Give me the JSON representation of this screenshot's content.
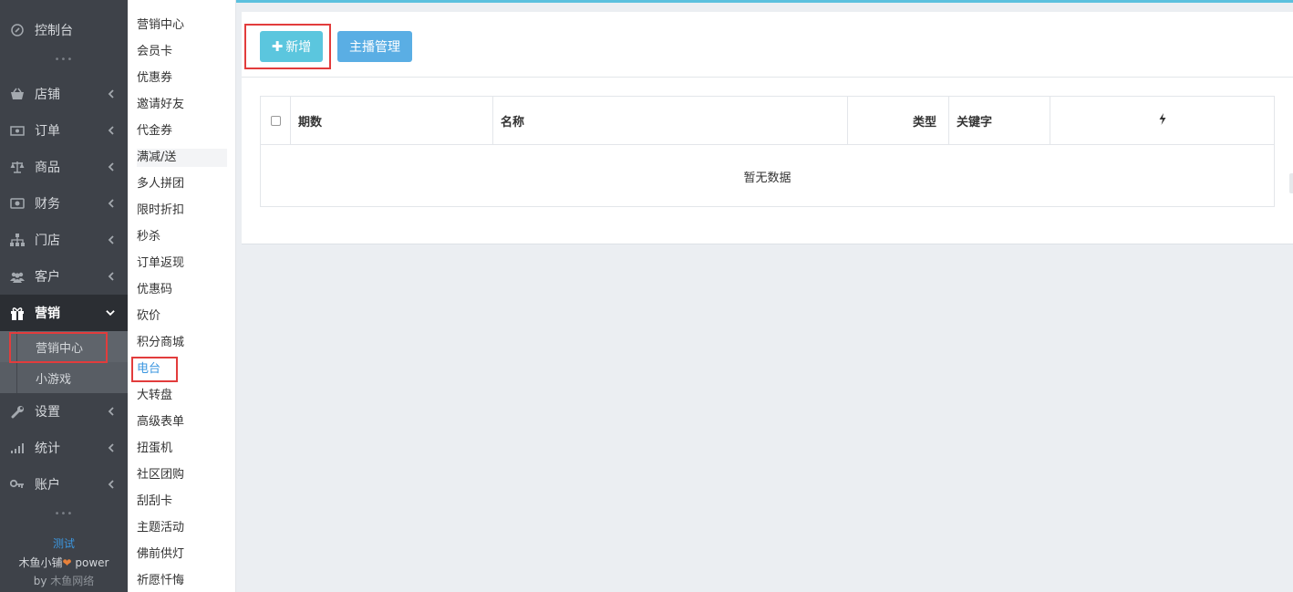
{
  "sidebar": {
    "items": [
      {
        "label": "控制台",
        "icon": "dashboard-icon"
      },
      {
        "label": "店铺",
        "icon": "basket-icon"
      },
      {
        "label": "订单",
        "icon": "money-icon"
      },
      {
        "label": "商品",
        "icon": "balance-scale-icon"
      },
      {
        "label": "财务",
        "icon": "cash-icon"
      },
      {
        "label": "门店",
        "icon": "sitemap-icon"
      },
      {
        "label": "客户",
        "icon": "users-icon"
      },
      {
        "label": "营销",
        "icon": "gift-icon"
      },
      {
        "label": "设置",
        "icon": "wrench-icon"
      },
      {
        "label": "统计",
        "icon": "signal-icon"
      },
      {
        "label": "账户",
        "icon": "key-icon"
      }
    ],
    "dots": "•••",
    "sub_items": [
      "营销中心",
      "小游戏"
    ],
    "footer": {
      "shop_name": "测试",
      "brand_prefix": "木鱼小铺",
      "brand_suffix": " power",
      "by_prefix": "by ",
      "company": "木鱼网络"
    },
    "colors": {
      "accent": "#3c97e0",
      "heart": "#e8813a"
    }
  },
  "submenu": {
    "items": [
      "营销中心",
      "会员卡",
      "优惠券",
      "邀请好友",
      "代金券",
      "满减/送",
      "多人拼团",
      "限时折扣",
      "秒杀",
      "订单返现",
      "优惠码",
      "砍价",
      "积分商城",
      "电台",
      "大转盘",
      "高级表单",
      "扭蛋机",
      "社区团购",
      "刮刮卡",
      "主题活动",
      "佛前供灯",
      "祈愿忏悔"
    ],
    "active": "电台"
  },
  "toolbar": {
    "add_label": "新增",
    "host_label": "主播管理"
  },
  "table": {
    "columns": [
      "期数",
      "名称",
      "类型",
      "关键字"
    ],
    "empty_text": "暂无数据"
  }
}
